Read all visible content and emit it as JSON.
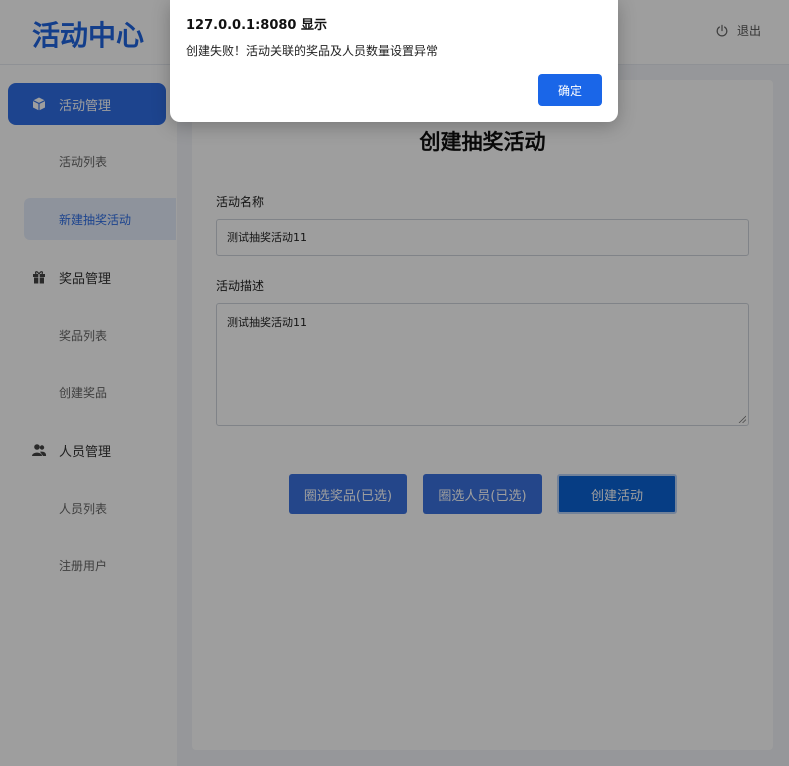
{
  "header": {
    "logo": "活动中心",
    "logout_label": "退出"
  },
  "sidebar": {
    "groups": [
      {
        "label": "活动管理",
        "icon": "cube-icon",
        "active": true,
        "items": [
          {
            "label": "活动列表",
            "active": false
          },
          {
            "label": "新建抽奖活动",
            "active": true
          }
        ]
      },
      {
        "label": "奖品管理",
        "icon": "gift-icon",
        "active": false,
        "items": [
          {
            "label": "奖品列表",
            "active": false
          },
          {
            "label": "创建奖品",
            "active": false
          }
        ]
      },
      {
        "label": "人员管理",
        "icon": "users-icon",
        "active": false,
        "items": [
          {
            "label": "人员列表",
            "active": false
          },
          {
            "label": "注册用户",
            "active": false
          }
        ]
      }
    ]
  },
  "form": {
    "title": "创建抽奖活动",
    "name_label": "活动名称",
    "name_value": "测试抽奖活动11",
    "desc_label": "活动描述",
    "desc_value": "测试抽奖活动11",
    "select_prizes_label": "圈选奖品(已选)",
    "select_people_label": "圈选人员(已选)",
    "create_label": "创建活动"
  },
  "dialog": {
    "title": "127.0.0.1:8080 显示",
    "message": "创建失败！活动关联的奖品及人员数量设置异常",
    "ok_label": "确定"
  },
  "colors": {
    "accent": "#2f6fe6",
    "dialog_button": "#1a66e8"
  }
}
